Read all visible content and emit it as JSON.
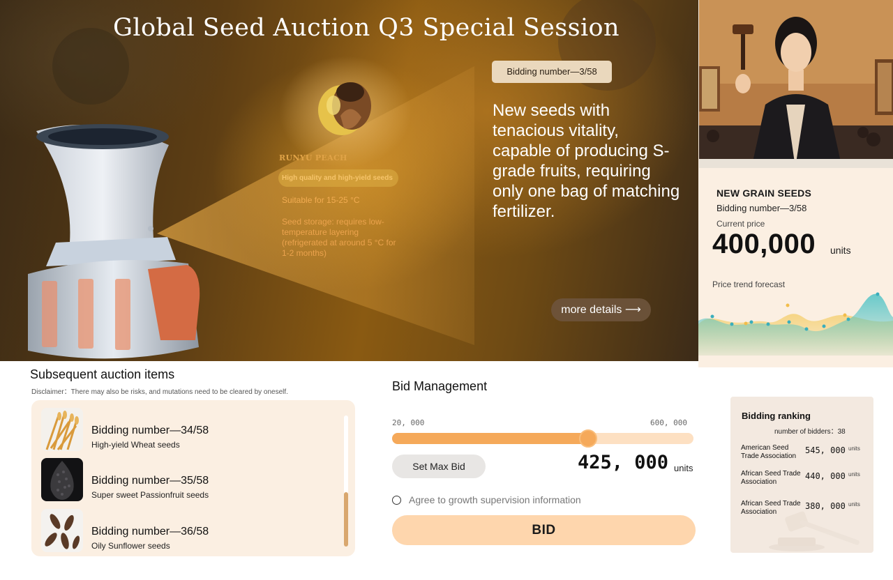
{
  "hero": {
    "title": "Global Seed Auction Q3 Special Session",
    "bid_chip": "Bidding number—3/58",
    "description": "New seeds with tenacious vitality, capable of producing S-grade fruits, requiring only one bag of matching fertilizer.",
    "more_details": "more details ⟶",
    "seed": {
      "name": "RUNYU PEACH",
      "tag": "High quality and high-yield seeds",
      "temperature": "Suitable for 15-25 °C",
      "storage": "Seed storage: requires low-temperature layering (refrigerated at around 5 °C for 1-2 months)"
    }
  },
  "current_lot": {
    "heading": "NEW GRAIN SEEDS",
    "bidding_number": "Bidding number—3/58",
    "current_price_label": "Current price",
    "current_price": "400,000",
    "unit": "units",
    "trend_label": "Price trend forecast",
    "trend_colors": {
      "teal": "#4fc3c6",
      "yellow": "#f5d27a"
    }
  },
  "subsequent": {
    "title": "Subsequent auction items",
    "disclaimer": "Disclaimer：There may also be risks, and mutations need to be cleared by oneself.",
    "items": [
      {
        "number": "Bidding number—34/58",
        "name": "High-yield Wheat seeds",
        "icon": "wheat-icon"
      },
      {
        "number": "Bidding number—35/58",
        "name": "Super sweet Passionfruit  seeds",
        "icon": "passionfruit-seed-icon"
      },
      {
        "number": "Bidding number—36/58",
        "name": "Oily Sunflower seeds",
        "icon": "sunflower-seed-icon"
      }
    ]
  },
  "bid_management": {
    "title": "Bid Management",
    "range_min": "20, 000",
    "range_max": "600, 000",
    "slider_fraction": 0.65,
    "set_max_bid": "Set Max Bid",
    "bid_value": "425, 000",
    "unit": "units",
    "agree_text": "Agree to growth supervision information",
    "bid_button": "BID",
    "accent": "#f5a95a"
  },
  "ranking": {
    "title": "Bidding ranking",
    "count": "number of bidders：38",
    "rows": [
      {
        "name": "American Seed Trade Association",
        "amount": "545, 000",
        "unit": "units"
      },
      {
        "name": "African Seed Trade Association",
        "amount": "440, 000",
        "unit": "units"
      },
      {
        "name": "African Seed Trade Association",
        "amount": "380, 000",
        "unit": "units"
      }
    ]
  }
}
